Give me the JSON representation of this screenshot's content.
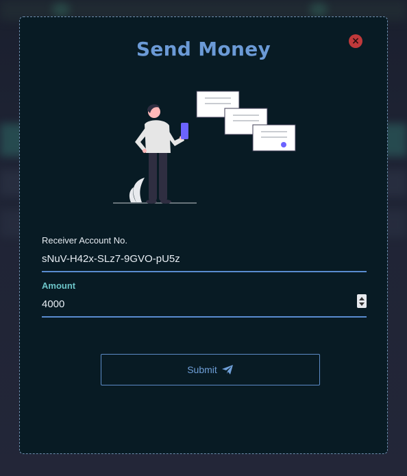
{
  "modal": {
    "title": "Send Money",
    "close_icon": "close-icon",
    "receiver": {
      "label": "Receiver Account No.",
      "value": "sNuV-H42x-SLz7-9GVO-pU5z"
    },
    "amount": {
      "label": "Amount",
      "value": "4000"
    },
    "submit": {
      "label": "Submit",
      "icon": "paper-plane-icon"
    }
  },
  "colors": {
    "title": "#6b9ad6",
    "accent_label": "#6cc4c8",
    "underline": "#5a8cd0",
    "close": "#c0393b",
    "modal_bg": "#081b24"
  }
}
